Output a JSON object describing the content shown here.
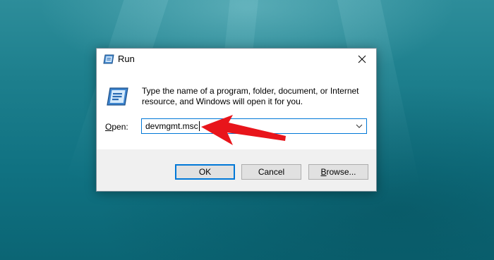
{
  "dialog": {
    "title": "Run",
    "icon": "run-icon",
    "close_icon": "close-icon",
    "description": "Type the name of a program, folder, document, or Internet resource, and Windows will open it for you.",
    "open_label_accel": "O",
    "open_label_rest": "pen:",
    "open_value": "devmgmt.msc",
    "dropdown_icon": "chevron-down-icon",
    "buttons": {
      "ok": "OK",
      "cancel": "Cancel",
      "browse_accel": "B",
      "browse_rest": "rowse..."
    }
  },
  "annotation": {
    "icon": "red-arrow-icon",
    "color": "#e8151b"
  },
  "colors": {
    "accent": "#0078d7",
    "button_bg": "#e1e1e1",
    "footer_bg": "#f0f0f0",
    "desktop": "#1d7f8d"
  }
}
